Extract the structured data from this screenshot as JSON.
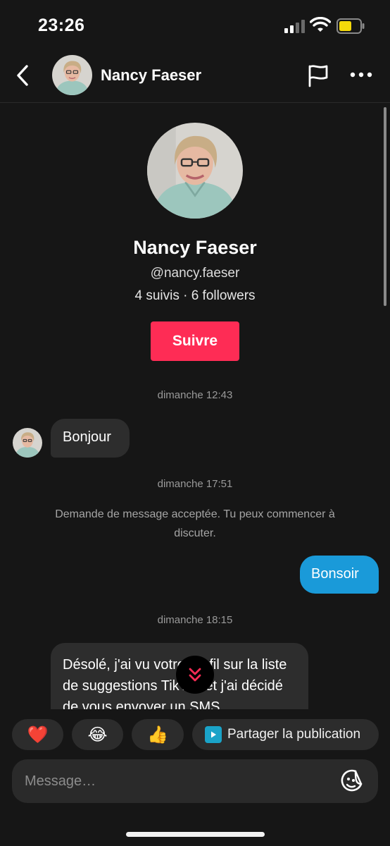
{
  "status_bar": {
    "time": "23:26"
  },
  "header": {
    "title": "Nancy Faeser",
    "icons": {
      "back": "chevron-left-icon",
      "report": "flag-icon",
      "more": "more-horizontal-icon"
    }
  },
  "profile": {
    "name": "Nancy Faeser",
    "handle": "@nancy.faeser",
    "stats": "4 suivis · 6 followers",
    "follow_label": "Suivre"
  },
  "messages": {
    "stamp1": "dimanche 12:43",
    "msg1": "Bonjour",
    "stamp2": "dimanche 17:51",
    "system": "Demande de message acceptée. Tu peux commencer à discuter.",
    "msg2": "Bonsoir",
    "stamp3": "dimanche 18:15",
    "msg3": "Désolé, j'ai vu votre profil sur la liste de suggestions TikTok et j'ai décidé de vous envoyer un SMS"
  },
  "quick_actions": {
    "heart": "❤️",
    "laugh": "😂",
    "thumbs": "👍",
    "share_label": "Partager la publication"
  },
  "composer": {
    "placeholder": "Message…"
  },
  "colors": {
    "accent": "#fe2c55",
    "outgoing_bubble": "#1a9ad9",
    "background": "#161616"
  }
}
